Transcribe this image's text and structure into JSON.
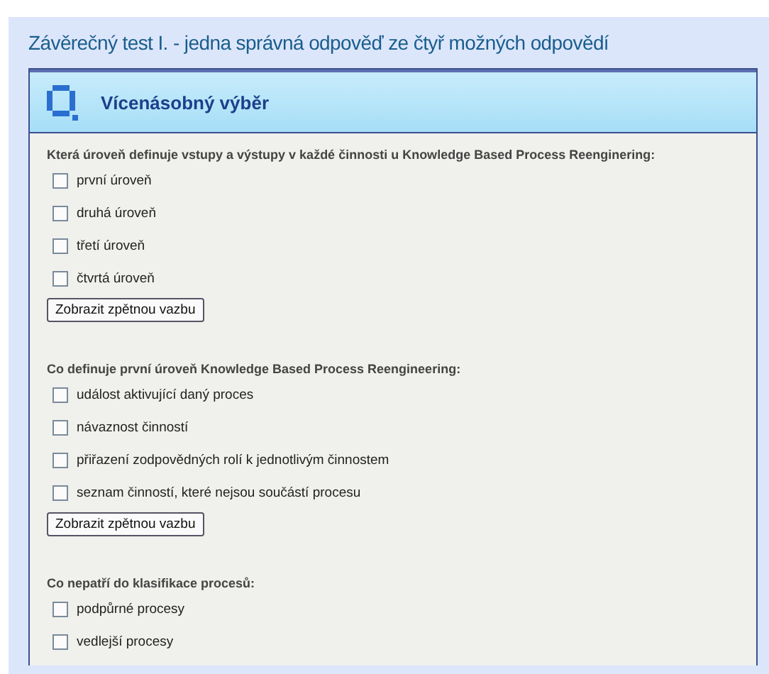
{
  "page_title": "Závěrečný test I. - jedna správná odpověď ze čtyř možných odpovědí",
  "panel": {
    "title": "Vícenásobný výběr"
  },
  "questions": [
    {
      "text": "Která úroveň definuje vstupy a výstupy v každé činnosti u Knowledge Based Process Reenginering:",
      "options": [
        {
          "label": "první úroveň",
          "checked": false
        },
        {
          "label": "druhá úroveň",
          "checked": false
        },
        {
          "label": "třetí úroveň",
          "checked": false
        },
        {
          "label": "čtvrtá úroveň",
          "checked": false
        }
      ],
      "button": "Zobrazit zpětnou vazbu"
    },
    {
      "text": "Co definuje první úroveň Knowledge Based Process Reengineering:",
      "options": [
        {
          "label": "událost aktivující daný proces",
          "checked": false
        },
        {
          "label": "návaznost činností",
          "checked": false
        },
        {
          "label": "přiřazení zodpovědných rolí k jednotlivým činnostem",
          "checked": false
        },
        {
          "label": "seznam činností, které nejsou součástí procesu",
          "checked": false
        }
      ],
      "button": "Zobrazit zpětnou vazbu"
    },
    {
      "text": "Co nepatří do klasifikace procesů:",
      "options": [
        {
          "label": "podpůrné procesy",
          "checked": false
        },
        {
          "label": "vedlejší procesy",
          "checked": false
        }
      ]
    }
  ]
}
